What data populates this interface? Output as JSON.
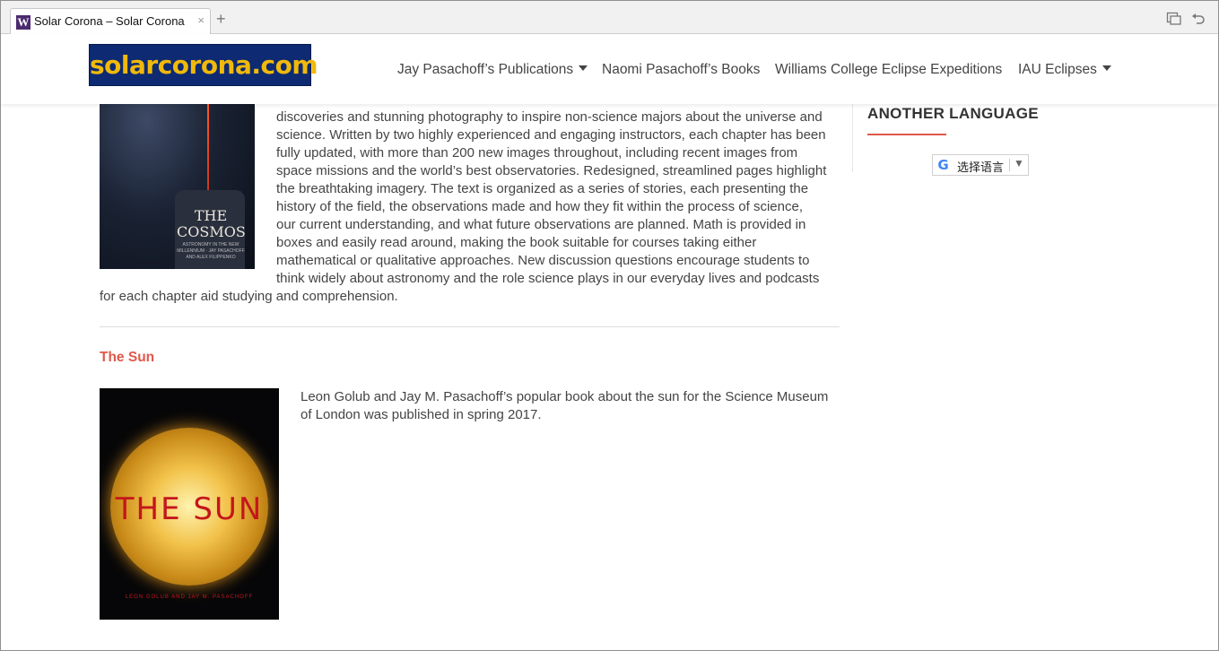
{
  "browser": {
    "tab_title": "Solar Corona – Solar Corona",
    "favicon_letter": "W",
    "close_glyph": "×",
    "new_tab_glyph": "+"
  },
  "header": {
    "logo_text": "solarcorona.com",
    "nav": [
      {
        "label": "Jay Pasachoff’s Publications",
        "has_dropdown": true
      },
      {
        "label": "Naomi Pasachoff’s Books",
        "has_dropdown": false
      },
      {
        "label": "Williams College Eclipse Expeditions",
        "has_dropdown": false
      },
      {
        "label": "IAU Eclipses",
        "has_dropdown": true
      }
    ]
  },
  "book1": {
    "cover_title": "THE COSMOS",
    "cover_subtitle": "ASTRONOMY IN THE NEW MILLENNIUM · JAY PASACHOFF AND ALEX FILIPPENKO",
    "lines": [
      "discoveries and stunning photography to inspire non-science majors about the universe and",
      "science. Written by two highly experienced and engaging instructors, each chapter has been",
      "fully updated, with more than 200 new images throughout, including recent images from",
      "space missions and the world’s best observatories. Redesigned, streamlined pages highlight",
      "the breathtaking imagery. The text is organized as a series of stories, each presenting the",
      "history of the field, the observations made and how they fit within the process of science,",
      "our current understanding, and what future observations are planned. Math is provided in",
      "boxes and easily read around, making the book suitable for courses taking either",
      "mathematical or qualitative approaches. New discussion questions encourage students to",
      "think widely about astronomy and the role science plays in our everyday lives and podcasts",
      "for each chapter aid studying and comprehension."
    ]
  },
  "book2": {
    "title": "The Sun",
    "cover_title": "THE SUN",
    "cover_authors": "LEON GOLUB AND JAY M. PASACHOFF",
    "description": "Leon Golub and Jay M. Pasachoff’s popular book about the sun for the Science Museum of London was published in spring 2017."
  },
  "sidebar": {
    "widget_title": "ANOTHER LANGUAGE",
    "translate_label": "选择语言",
    "translate_arrow": "▼",
    "google_glyph": "G"
  },
  "colors": {
    "accent": "#e0584a",
    "logo_bg": "#0d2a72",
    "logo_text": "#f0b90b"
  }
}
